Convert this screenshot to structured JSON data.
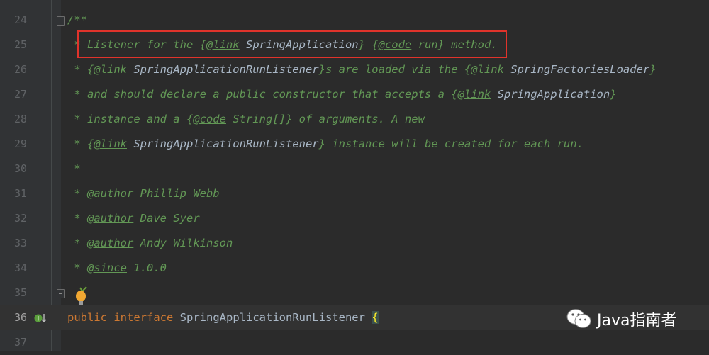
{
  "editor": {
    "lines": [
      {
        "num": "24",
        "tokens": [
          [
            "c",
            "/**"
          ]
        ]
      },
      {
        "num": "25",
        "tokens": [
          [
            "c",
            " * Listener for the "
          ],
          [
            "c",
            "{"
          ],
          [
            "t",
            "@link"
          ],
          [
            "r",
            " SpringApplication"
          ],
          [
            "c",
            "} {"
          ],
          [
            "t",
            "@code"
          ],
          [
            "c",
            " run} method."
          ]
        ]
      },
      {
        "num": "26",
        "tokens": [
          [
            "c",
            " * {"
          ],
          [
            "t",
            "@link"
          ],
          [
            "r",
            " SpringApplicationRunListener"
          ],
          [
            "c",
            "}s are loaded via the {"
          ],
          [
            "t",
            "@link"
          ],
          [
            "r",
            " SpringFactoriesLoader"
          ],
          [
            "c",
            "}"
          ]
        ]
      },
      {
        "num": "27",
        "tokens": [
          [
            "c",
            " * and should declare a public constructor that accepts a {"
          ],
          [
            "t",
            "@link"
          ],
          [
            "r",
            " SpringApplication"
          ],
          [
            "c",
            "}"
          ]
        ]
      },
      {
        "num": "28",
        "tokens": [
          [
            "c",
            " * instance and a {"
          ],
          [
            "t",
            "@code"
          ],
          [
            "c",
            " String[]} of arguments. A new"
          ]
        ]
      },
      {
        "num": "29",
        "tokens": [
          [
            "c",
            " * {"
          ],
          [
            "t",
            "@link"
          ],
          [
            "r",
            " SpringApplicationRunListener"
          ],
          [
            "c",
            "} instance will be created for each run."
          ]
        ]
      },
      {
        "num": "30",
        "tokens": [
          [
            "c",
            " *"
          ]
        ]
      },
      {
        "num": "31",
        "tokens": [
          [
            "c",
            " * "
          ],
          [
            "t",
            "@author"
          ],
          [
            "c",
            " Phillip Webb"
          ]
        ]
      },
      {
        "num": "32",
        "tokens": [
          [
            "c",
            " * "
          ],
          [
            "t",
            "@author"
          ],
          [
            "c",
            " Dave Syer"
          ]
        ]
      },
      {
        "num": "33",
        "tokens": [
          [
            "c",
            " * "
          ],
          [
            "t",
            "@author"
          ],
          [
            "c",
            " Andy Wilkinson"
          ]
        ]
      },
      {
        "num": "34",
        "tokens": [
          [
            "c",
            " * "
          ],
          [
            "t",
            "@since"
          ],
          [
            "c",
            " 1.0.0"
          ]
        ]
      },
      {
        "num": "35",
        "tokens": [
          [
            "c",
            " "
          ]
        ]
      },
      {
        "num": "36",
        "current": true,
        "tokens": [
          [
            "k",
            "public"
          ],
          [
            "p",
            " "
          ],
          [
            "k",
            "interface"
          ],
          [
            "p",
            " SpringApplicationRunListener "
          ],
          [
            "b",
            "{"
          ]
        ]
      },
      {
        "num": "37",
        "tokens": []
      }
    ]
  },
  "watermark": {
    "text": "Java指南者"
  },
  "colors": {
    "background": "#2b2b2b",
    "comment": "#629755",
    "keyword": "#cc7832",
    "highlight_box": "#e0332b"
  }
}
